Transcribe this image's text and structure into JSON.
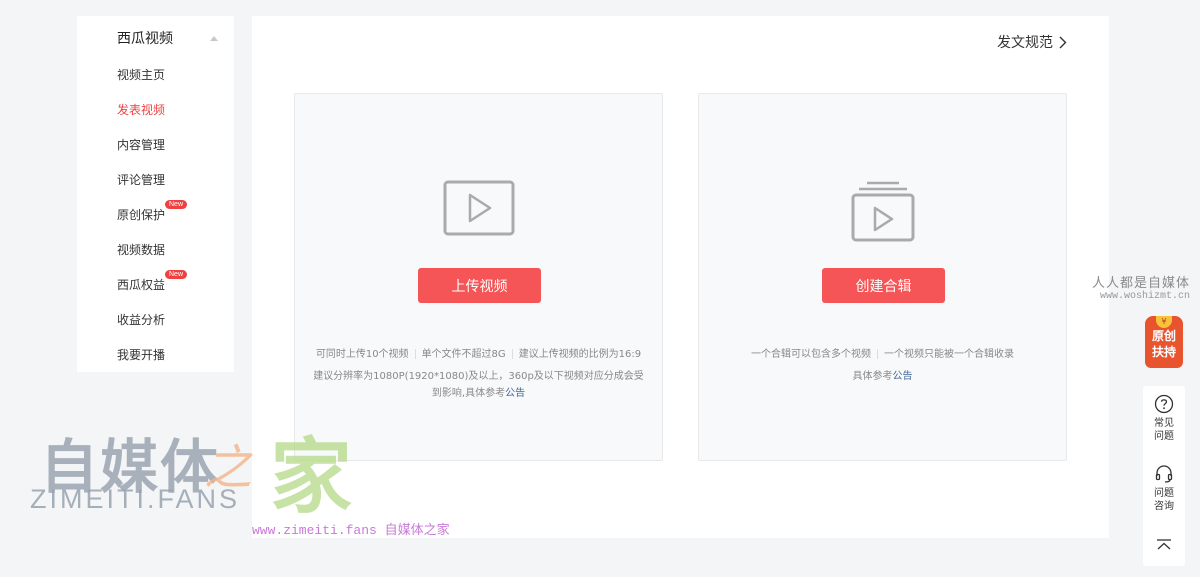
{
  "sidebar": {
    "title": "西瓜视频",
    "items": [
      {
        "label": "视频主页",
        "active": false,
        "badge": ""
      },
      {
        "label": "发表视频",
        "active": true,
        "badge": ""
      },
      {
        "label": "内容管理",
        "active": false,
        "badge": ""
      },
      {
        "label": "评论管理",
        "active": false,
        "badge": ""
      },
      {
        "label": "原创保护",
        "active": false,
        "badge": "New"
      },
      {
        "label": "视频数据",
        "active": false,
        "badge": ""
      },
      {
        "label": "西瓜权益",
        "active": false,
        "badge": "New"
      },
      {
        "label": "收益分析",
        "active": false,
        "badge": ""
      },
      {
        "label": "我要开播",
        "active": false,
        "badge": ""
      }
    ]
  },
  "main": {
    "rules_link": "发文规范",
    "upload_card": {
      "button": "上传视频",
      "note_parts": [
        "可同时上传10个视频",
        "单个文件不超过8G",
        "建议上传视频的比例为16:9"
      ],
      "note_second": "建议分辨率为1080P(1920*1080)及以上，360p及以下视频对应分成会受到影响,具体参考",
      "link": "公告"
    },
    "collection_card": {
      "button": "创建合辑",
      "note_parts": [
        "一个合辑可以包含多个视频",
        "一个视频只能被一个合辑收录"
      ],
      "note_second": "具体参考",
      "link": "公告"
    }
  },
  "watermark": {
    "right_line1": "人人都是自媒体",
    "right_line2": "www.woshizmt.cn",
    "logo_zh": "自媒体",
    "logo_zhi": "之",
    "logo_jia": "家",
    "logo_en": "ZIMEITI.FANS",
    "logo_url": "www.zimeiti.fans 自媒体之家"
  },
  "float_tools": {
    "badge_line1": "原创",
    "badge_line2": "扶持",
    "faq": "常见问题",
    "consult": "问题咨询"
  },
  "colors": {
    "accent": "#f04142",
    "button": "#f55556",
    "link": "#406599",
    "background": "#f4f5f6"
  }
}
